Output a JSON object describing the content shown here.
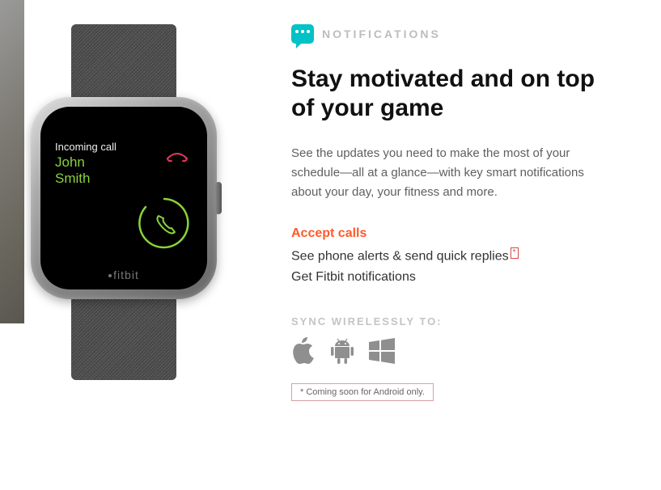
{
  "section": {
    "label": "NOTIFICATIONS"
  },
  "headline": "Stay motivated and on top of your game",
  "body": "See the updates you need to make the most of your schedule—all at a glance—with key smart notifications about your day, your fitness and more.",
  "features": {
    "accept_calls": "Accept calls",
    "phone_alerts": "See phone alerts & send quick replies",
    "phone_alerts_marker": "*",
    "fitbit_notifs": "Get Fitbit notifications"
  },
  "sync": {
    "label": "SYNC WIRELESSLY TO:"
  },
  "footnote": "* Coming soon for Android only.",
  "watch": {
    "incoming_label": "Incoming call",
    "caller_first": "John",
    "caller_last": "Smith",
    "brand": "fitbit"
  }
}
